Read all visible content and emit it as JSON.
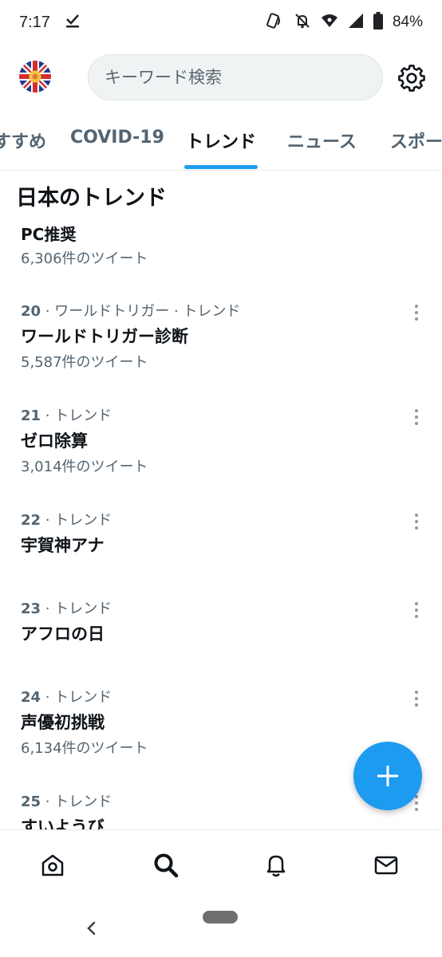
{
  "status_bar": {
    "time": "7:17",
    "battery": "84%"
  },
  "search": {
    "placeholder": "キーワード検索"
  },
  "tabs": [
    {
      "label": "すすめ",
      "active": false
    },
    {
      "label": "COVID-19",
      "active": false
    },
    {
      "label": "トレンド",
      "active": true
    },
    {
      "label": "ニュース",
      "active": false
    },
    {
      "label": "スポーツ",
      "active": false
    }
  ],
  "section_title": "日本のトレンド",
  "trends": [
    {
      "meta_num": "",
      "meta_rest": "",
      "name": "PC推奨",
      "count": "6,306件のツイート"
    },
    {
      "meta_num": "20",
      "meta_rest": " · ワールドトリガー · トレンド",
      "name": "ワールドトリガー診断",
      "count": "5,587件のツイート"
    },
    {
      "meta_num": "21",
      "meta_rest": " · トレンド",
      "name": "ゼロ除算",
      "count": "3,014件のツイート"
    },
    {
      "meta_num": "22",
      "meta_rest": " · トレンド",
      "name": "宇賀神アナ",
      "count": ""
    },
    {
      "meta_num": "23",
      "meta_rest": " · トレンド",
      "name": "アフロの日",
      "count": ""
    },
    {
      "meta_num": "24",
      "meta_rest": " · トレンド",
      "name": "声優初挑戦",
      "count": "6,134件のツイート"
    },
    {
      "meta_num": "25",
      "meta_rest": " · トレンド",
      "name": "すいようび",
      "count": ""
    }
  ],
  "colors": {
    "accent": "#1d9bf0",
    "text_primary": "#0f1419",
    "text_secondary": "#536471"
  },
  "icons": {
    "settings": "gear-icon",
    "compose": "plus-icon",
    "nav": [
      "home-icon",
      "search-icon",
      "bell-icon",
      "mail-icon"
    ]
  }
}
